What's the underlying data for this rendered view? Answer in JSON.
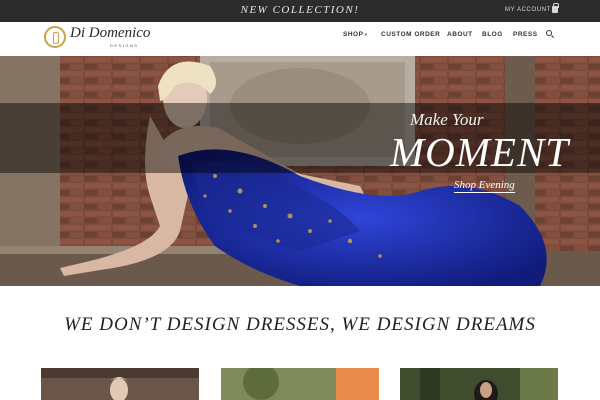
{
  "topbar": {
    "promo": "NEW COLLECTION!",
    "account": "MY ACCOUNT",
    "cart_icon": "shopping-bag-icon"
  },
  "brand": {
    "name": "Di Domenico",
    "tagline": "DESIGNS",
    "accent": "#c9a24a"
  },
  "nav": {
    "items": [
      {
        "label": "SHOP",
        "has_dropdown": true
      },
      {
        "label": "CUSTOM ORDER"
      },
      {
        "label": "ABOUT"
      },
      {
        "label": "BLOG"
      },
      {
        "label": "PRESS"
      }
    ],
    "search_icon": "search-icon"
  },
  "hero": {
    "kicker": "Make Your",
    "title": "MOMENT",
    "cta": "Shop Evening",
    "dress_color": "#1f2fae"
  },
  "tagline": "WE DON’T DESIGN DRESSES, WE DESIGN DREAMS"
}
